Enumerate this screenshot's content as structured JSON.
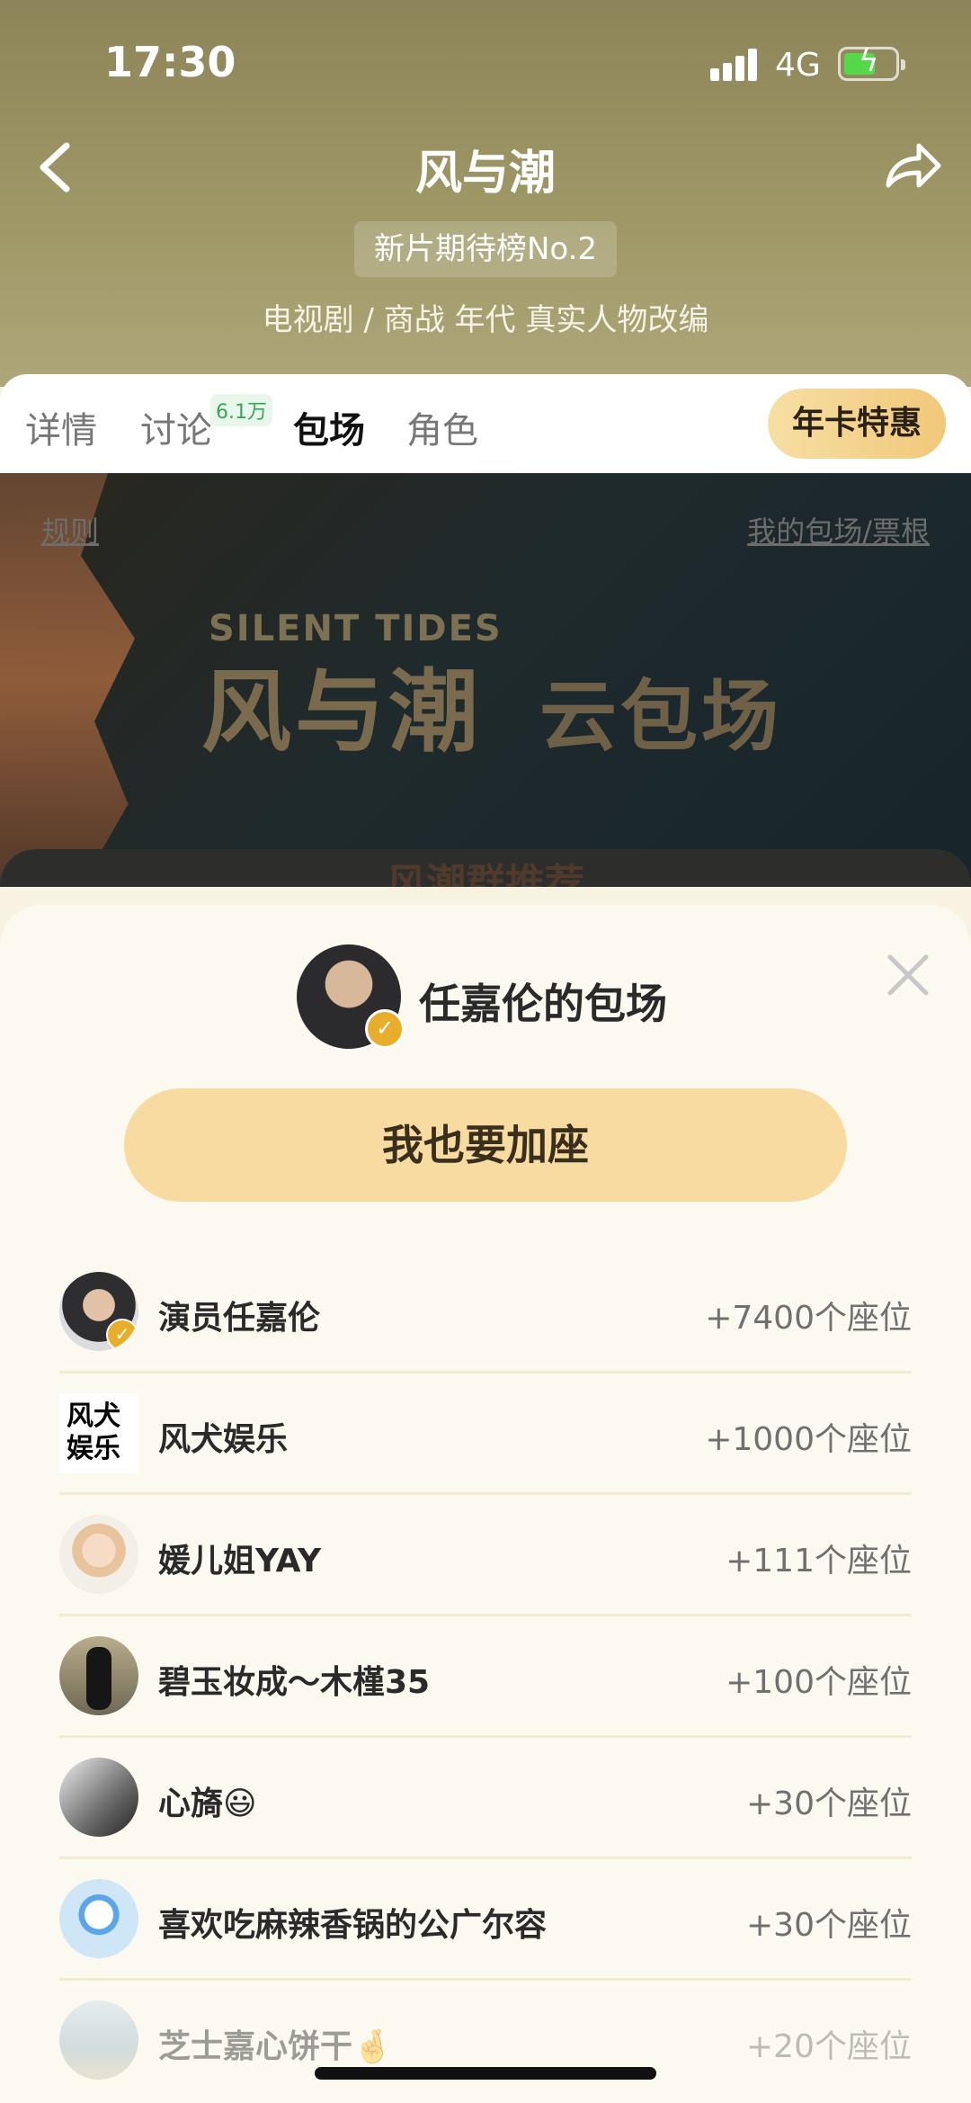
{
  "status_bar": {
    "time": "17:30",
    "network": "4G"
  },
  "header": {
    "title": "风与潮",
    "rank_badge": "新片期待榜No.2",
    "genre": "电视剧 / 商战 年代 真实人物改编"
  },
  "tabs": [
    {
      "label": "详情"
    },
    {
      "label": "讨论",
      "count": "6.1万"
    },
    {
      "label": "包场"
    },
    {
      "label": "角色"
    }
  ],
  "vip_button": "年卡特惠",
  "banner": {
    "rules_link": "规则",
    "my_link": "我的包场/票根",
    "title_en": "SILENT TIDES",
    "title_cn": "风与潮",
    "subtitle": "云包场",
    "lower_text": "风潮群推荐"
  },
  "sheet": {
    "title": "任嘉伦的包场",
    "join_button": "我也要加座",
    "rows": [
      {
        "name": "演员任嘉伦",
        "seats": "+7400个座位",
        "avatar_icon": "portrait"
      },
      {
        "name": "风犬娱乐",
        "seats": "+1000个座位",
        "avatar_icon": "logo",
        "logo_text": "风犬娱乐"
      },
      {
        "name": "媛儿姐YAY",
        "seats": "+111个座位",
        "avatar_icon": "cartoon-girl"
      },
      {
        "name": "碧玉妆成～木槿35",
        "seats": "+100个座位",
        "avatar_icon": "figure"
      },
      {
        "name": "心旖😃",
        "seats": "+30个座位",
        "avatar_icon": "bw-photo"
      },
      {
        "name": "喜欢吃麻辣香锅的公广尔容",
        "seats": "+30个座位",
        "avatar_icon": "blue-cartoon"
      },
      {
        "name": "芝士嘉心饼干🤞",
        "seats": "+20个座位",
        "avatar_icon": "sky-photo"
      }
    ]
  },
  "colors": {
    "accent": "#f8dba1",
    "header_bg": "#9b9462",
    "badge": "#e8ad2b"
  }
}
